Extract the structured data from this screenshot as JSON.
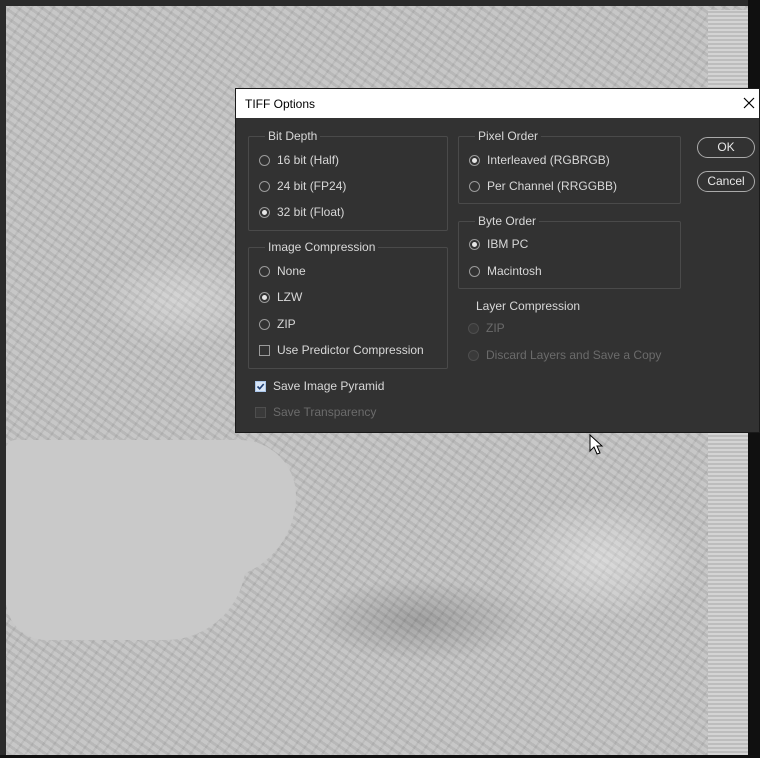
{
  "dialog": {
    "title": "TIFF Options",
    "close_icon": "close-icon",
    "ok_label": "OK",
    "cancel_label": "Cancel"
  },
  "bit_depth": {
    "legend": "Bit Depth",
    "options": [
      "16 bit (Half)",
      "24 bit (FP24)",
      "32 bit (Float)"
    ],
    "selected": "32 bit (Float)"
  },
  "image_compression": {
    "legend": "Image Compression",
    "options": [
      "None",
      "LZW",
      "ZIP"
    ],
    "selected": "LZW",
    "predictor_label": "Use Predictor Compression",
    "predictor_checked": false
  },
  "pixel_order": {
    "legend": "Pixel Order",
    "options": [
      "Interleaved (RGBRGB)",
      "Per Channel (RRGGBB)"
    ],
    "selected": "Interleaved (RGBRGB)"
  },
  "byte_order": {
    "legend": "Byte Order",
    "options": [
      "IBM PC",
      "Macintosh"
    ],
    "selected": "IBM PC"
  },
  "layer_compression": {
    "legend": "Layer Compression",
    "options": [
      "ZIP",
      "Discard Layers and Save a Copy"
    ],
    "disabled": true
  },
  "save_image_pyramid": {
    "label": "Save Image Pyramid",
    "checked": true
  },
  "save_transparency": {
    "label": "Save Transparency",
    "checked": false,
    "disabled": true
  },
  "background": {
    "description_icon": "hillshade-terrain-image"
  },
  "cursor_icon": "arrow-cursor-icon"
}
